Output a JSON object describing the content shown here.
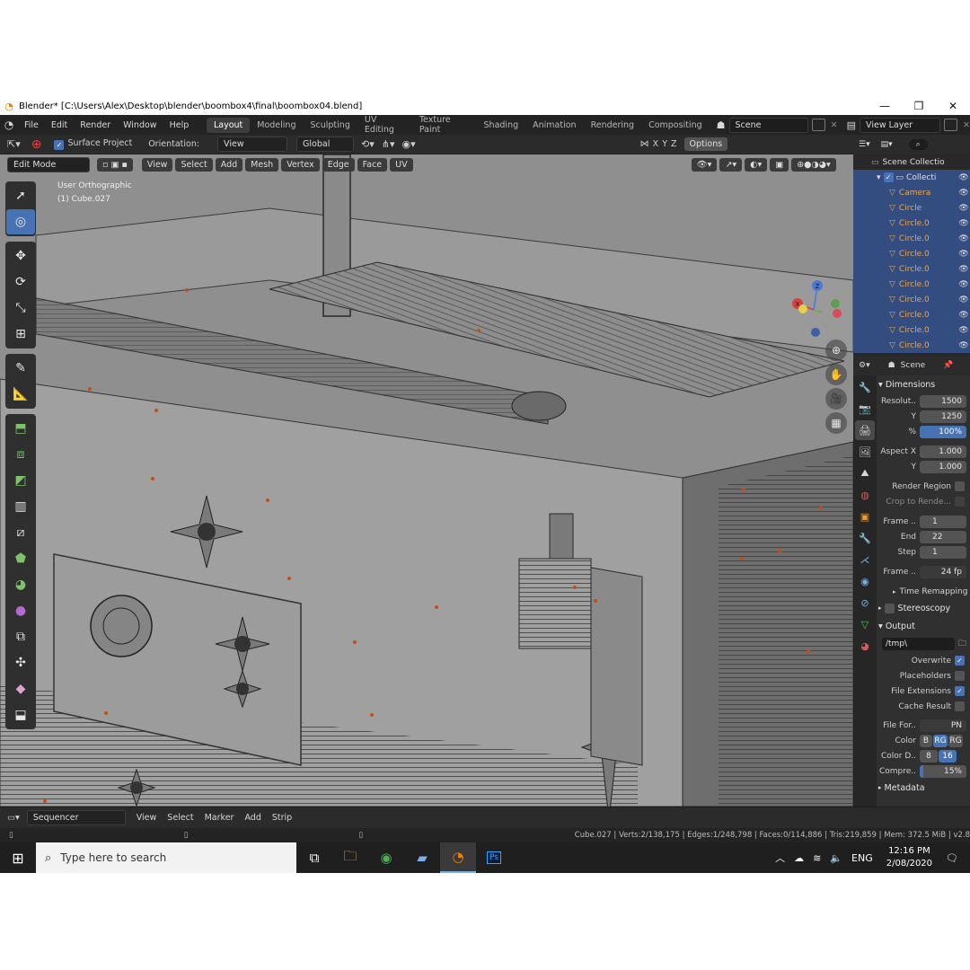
{
  "window": {
    "title": "Blender* [C:\\Users\\Alex\\Desktop\\blender\\boombox4\\final\\boombox04.blend]",
    "minimize": "—",
    "maximize": "❐",
    "close": "✕"
  },
  "menubar": {
    "items": [
      "File",
      "Edit",
      "Render",
      "Window",
      "Help"
    ],
    "workspaces": [
      "Layout",
      "Modeling",
      "Sculpting",
      "UV Editing",
      "Texture Paint",
      "Shading",
      "Animation",
      "Rendering",
      "Compositing"
    ],
    "scene": "Scene",
    "view_layer": "View Layer"
  },
  "tool_header": {
    "snap_label": "Surface Project",
    "orientation_label": "Orientation:",
    "orientation_value": "View",
    "transform_orientation": "Global",
    "axis_x": "X",
    "axis_y": "Y",
    "axis_z": "Z",
    "options": "Options"
  },
  "viewport_header": {
    "mode": "Edit Mode",
    "menus": [
      "View",
      "Select",
      "Add",
      "Mesh",
      "Vertex",
      "Edge",
      "Face",
      "UV"
    ]
  },
  "viewport": {
    "view_name": "User Orthographic",
    "object_name": "(1) Cube.027"
  },
  "outliner": {
    "root": "Scene Collectio",
    "collection": "Collecti",
    "items": [
      "Camera",
      "Circle",
      "Circle.0",
      "Circle.0",
      "Circle.0",
      "Circle.0",
      "Circle.0",
      "Circle.0",
      "Circle.0",
      "Circle.0",
      "Circle.0"
    ]
  },
  "properties": {
    "context": "Scene",
    "dimensions_title": "Dimensions",
    "resolution_x_label": "Resolut..",
    "resolution_x": "1500",
    "resolution_y_label": "Y",
    "resolution_y": "1250",
    "percent_label": "%",
    "percent": "100%",
    "aspect_x_label": "Aspect X",
    "aspect_x": "1.000",
    "aspect_y_label": "Y",
    "aspect_y": "1.000",
    "render_region": "Render Region",
    "crop_to_render": "Crop to Rende...",
    "frame_start_label": "Frame ..",
    "frame_start": "1",
    "frame_end_label": "End",
    "frame_end": "22",
    "frame_step_label": "Step",
    "frame_step": "1",
    "frame_rate_label": "Frame ..",
    "frame_rate": "24 fp",
    "time_remapping": "Time Remapping",
    "stereoscopy": "Stereoscopy",
    "output_title": "Output",
    "output_path": "/tmp\\",
    "overwrite": "Overwrite",
    "placeholders": "Placeholders",
    "file_extensions": "File Extensions",
    "cache_result": "Cache Result",
    "file_format_label": "File For..",
    "file_format": "PN",
    "color_label": "Color",
    "color_b": "B",
    "color_rg": "RG",
    "color_rgb": "RG",
    "color_depth_label": "Color D..",
    "color_depth_8": "8",
    "color_depth_16": "16",
    "compression_label": "Compre..",
    "compression": "15%",
    "metadata": "Metadata"
  },
  "sequencer": {
    "editor": "Sequencer",
    "menus": [
      "View",
      "Select",
      "Marker",
      "Add",
      "Strip"
    ]
  },
  "statusbar": {
    "stats": "Cube.027 | Verts:2/138,175 | Edges:1/248,798 | Faces:0/114,886 | Tris:219,859 | Mem: 372.5 MiB | v2.8"
  },
  "taskbar": {
    "search_placeholder": "Type here to search",
    "lang": "ENG",
    "time": "12:16 PM",
    "date": "2/08/2020"
  },
  "colors": {
    "accent": "#4772b3",
    "object_orange": "#e9a550",
    "viewport_bg": "#8a8a8a"
  }
}
